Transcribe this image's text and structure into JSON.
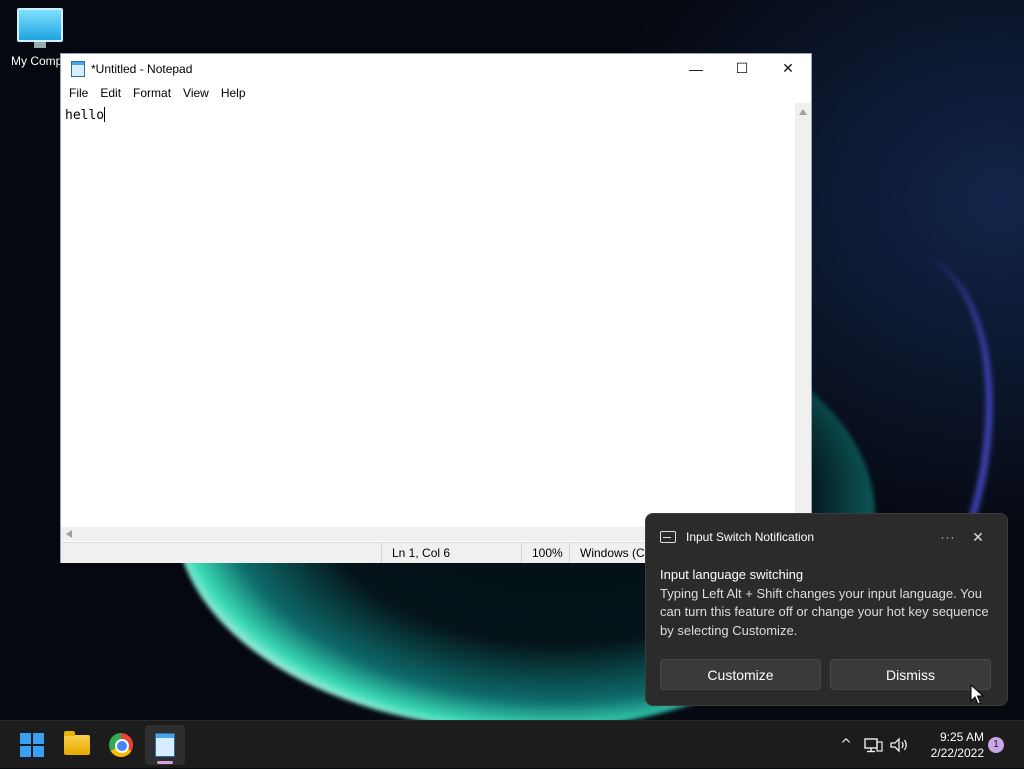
{
  "desktop": {
    "icons": [
      {
        "label": "My Compu",
        "icon": "monitor-icon"
      }
    ]
  },
  "notepad": {
    "title": "*Untitled - Notepad",
    "controls": {
      "minimize": "—",
      "maximize": "☐",
      "close": "✕"
    },
    "menu": [
      "File",
      "Edit",
      "Format",
      "View",
      "Help"
    ],
    "content": "hello",
    "status": {
      "position": "Ln 1, Col 6",
      "zoom": "100%",
      "encoding": "Windows (CRLF)"
    }
  },
  "toast": {
    "app_name": "Input Switch Notification",
    "more_label": "···",
    "close_label": "✕",
    "title": "Input language switching",
    "message": "Typing Left Alt + Shift changes your input language. You can turn this feature off or change your hot key sequence by selecting Customize.",
    "buttons": {
      "customize": "Customize",
      "dismiss": "Dismiss"
    }
  },
  "taskbar": {
    "apps": [
      {
        "name": "Start",
        "icon": "windows-logo-icon"
      },
      {
        "name": "File Explorer",
        "icon": "folder-icon"
      },
      {
        "name": "Google Chrome",
        "icon": "chrome-icon"
      },
      {
        "name": "Notepad",
        "icon": "notepad-icon",
        "active": true
      }
    ],
    "tray": {
      "chevron": "^",
      "time": "9:25 AM",
      "date": "2/22/2022",
      "notification_count": "1"
    }
  },
  "colors": {
    "accent": "#3aa0f3",
    "toast_bg": "#2b2b2b",
    "taskbar_bg": "#1c1c1c"
  }
}
